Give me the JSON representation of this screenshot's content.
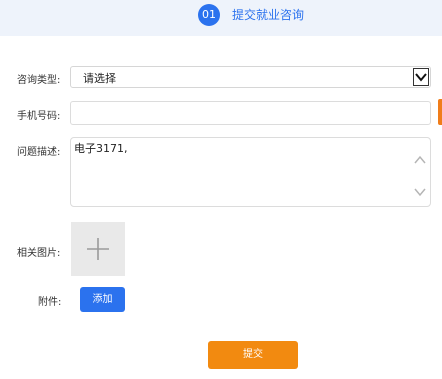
{
  "step": {
    "number": "01",
    "title": "提交就业咨询"
  },
  "form": {
    "type_label": "咨询类型:",
    "type_value": "请选择",
    "phone_label": "手机号码:",
    "phone_value": "",
    "desc_label": "问题描述:",
    "desc_value": "电子3171,",
    "image_label": "相关图片:",
    "attach_label": "附件:",
    "add_button": "添加",
    "submit_button": "提交"
  },
  "colors": {
    "primary": "#2b72ee",
    "accent": "#f28a10",
    "header_bg": "#eef3fb"
  }
}
